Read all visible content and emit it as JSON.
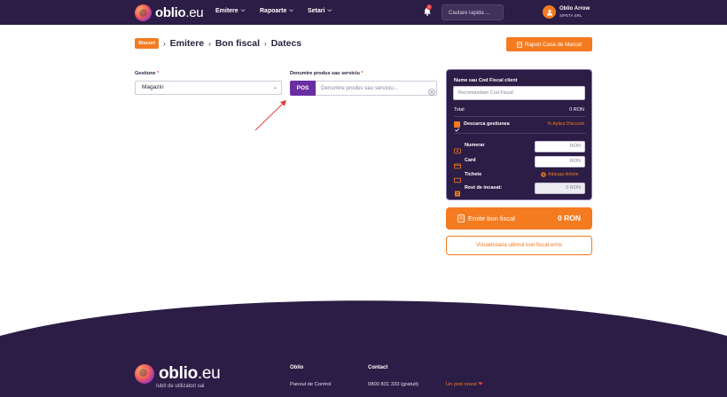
{
  "header": {
    "logo_text_bold": "oblio",
    "logo_text_light": ".eu",
    "nav": [
      {
        "label": "Emitere"
      },
      {
        "label": "Rapoarte"
      },
      {
        "label": "Setari"
      }
    ],
    "notifications_count": "1",
    "search_placeholder": "Cautare rapida ...",
    "user_name": "Oblio Arrow",
    "user_company": "SIPETA SRL"
  },
  "breadcrumb": {
    "badge": "Stocuri",
    "items": [
      "Emitere",
      "Bon fiscal",
      "Datecs"
    ]
  },
  "report_button": "Raport Casa de Marcat",
  "form": {
    "gestiune_label": "Gestiune",
    "gestiune_value": "Magazin",
    "produs_label": "Denumire produs sau serviciu",
    "pos_label": "POS",
    "produs_placeholder": "Denumire produs sau serviciu...",
    "required_mark": "*"
  },
  "panel": {
    "client_label": "Nume sau Cod Fiscal client",
    "client_placeholder": "Recomandam Cod Fiscal",
    "total_label": "Total",
    "total_value": "0 RON",
    "descarca_label": "Descarca gestiunea",
    "discount_link": "% Aplica Discount",
    "numerar_label": "Numerar",
    "numerar_unit": "RON",
    "card_label": "Card",
    "card_unit": "RON",
    "tichete_label": "Tichete",
    "tichete_link": "Adauga tichete",
    "rest_label": "Rest de incasat:",
    "rest_value": "0 RON"
  },
  "emite_button": {
    "label": "Emite bon fiscal",
    "amount": "0 RON"
  },
  "view_last_button": "Vizualizeaza ultimul bon fiscal emis",
  "footer": {
    "tagline": "Iubit de utilizatori sai",
    "col1_title": "Oblio",
    "col1_link": "Panoul de Control",
    "col2_title": "Contact",
    "col2_link": "0800 831 333 (gratuit)",
    "love_text": "Un pret onest"
  },
  "colors": {
    "brand_dark": "#2b1d45",
    "accent_orange": "#f47b20",
    "pos_purple": "#6a2ea3"
  }
}
